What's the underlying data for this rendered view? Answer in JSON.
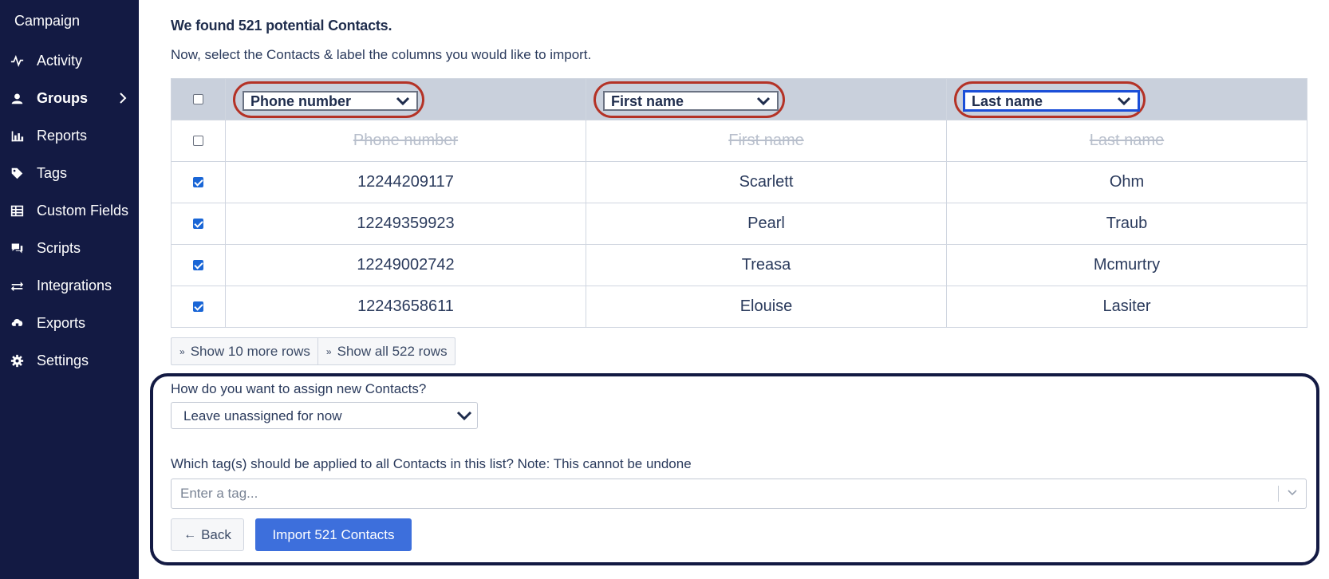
{
  "sidebar": {
    "brand": "Campaign",
    "items": [
      {
        "label": "Activity",
        "icon": "activity-icon"
      },
      {
        "label": "Groups",
        "icon": "users-icon",
        "active": true
      },
      {
        "label": "Reports",
        "icon": "bar-chart-icon"
      },
      {
        "label": "Tags",
        "icon": "tag-icon"
      },
      {
        "label": "Custom Fields",
        "icon": "table-icon"
      },
      {
        "label": "Scripts",
        "icon": "comments-icon"
      },
      {
        "label": "Integrations",
        "icon": "exchange-icon"
      },
      {
        "label": "Exports",
        "icon": "cloud-download-icon"
      },
      {
        "label": "Settings",
        "icon": "gear-icon"
      }
    ]
  },
  "main": {
    "found_text": "We found 521 potential Contacts.",
    "instructions": "Now, select the Contacts & label the columns you would like to import.",
    "columns": [
      {
        "select_value": "Phone number",
        "header_label": "Phone number"
      },
      {
        "select_value": "First name",
        "header_label": "First name"
      },
      {
        "select_value": "Last name",
        "header_label": "Last name"
      }
    ],
    "rows": [
      {
        "phone": "12244209117",
        "first": "Scarlett",
        "last": "Ohm",
        "checked": true
      },
      {
        "phone": "12249359923",
        "first": "Pearl",
        "last": "Traub",
        "checked": true
      },
      {
        "phone": "12249002742",
        "first": "Treasa",
        "last": "Mcmurtry",
        "checked": true
      },
      {
        "phone": "12243658611",
        "first": "Elouise",
        "last": "Lasiter",
        "checked": true
      }
    ],
    "show_more_label": "Show 10 more rows",
    "show_all_label": "Show all 522 rows",
    "assign_question": "How do you want to assign new Contacts?",
    "assign_value": "Leave unassigned for now",
    "tag_question": "Which tag(s) should be applied to all Contacts in this list? Note: This cannot be undone",
    "tag_placeholder": "Enter a tag...",
    "back_label": "Back",
    "import_label": "Import 521 Contacts"
  },
  "colors": {
    "sidebar_bg": "#131a43",
    "highlight_ring": "#b43226",
    "primary_button": "#3d6fdc",
    "header_bg": "#c9d0dc"
  }
}
